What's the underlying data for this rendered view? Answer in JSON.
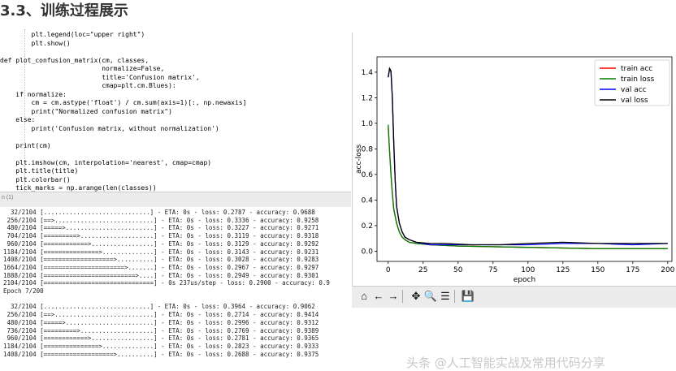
{
  "heading": "3.3、训练过程展示",
  "code_lines": [
    {
      "text": "        plt.legend(loc=\"upper right\")"
    },
    {
      "text": "        plt.show()"
    },
    {
      "text": ""
    },
    {
      "text": "def plot_confusion_matrix(cm, classes,"
    },
    {
      "text": "                          normalize=False,"
    },
    {
      "text": "                          title='Confusion matrix',"
    },
    {
      "text": "                          cmap=plt.cm.Blues):"
    },
    {
      "text": "    if normalize:"
    },
    {
      "text": "        cm = cm.astype('float') / cm.sum(axis=1)[:, np.newaxis]"
    },
    {
      "text": "        print(\"Normalized confusion matrix\")"
    },
    {
      "text": "    else:"
    },
    {
      "text": "        print('Confusion matrix, without normalization')"
    },
    {
      "text": ""
    },
    {
      "text": "    print(cm)"
    },
    {
      "text": ""
    },
    {
      "text": "    plt.imshow(cm, interpolation='nearest', cmap=cmap)"
    },
    {
      "text": "    plt.title(title)"
    },
    {
      "text": "    plt.colorbar()"
    },
    {
      "text": "    tick_marks = np.arange(len(classes))"
    }
  ],
  "panel_label": "n (1)",
  "console_lines": [
    "  32/2104 [.............................] - ETA: 0s - loss: 0.2787 - accuracy: 0.9688",
    " 256/2104 [==>...........................] - ETA: 0s - loss: 0.3336 - accuracy: 0.9258",
    " 480/2104 [=====>........................] - ETA: 0s - loss: 0.3227 - accuracy: 0.9271",
    " 704/2104 [=========>....................] - ETA: 0s - loss: 0.3119 - accuracy: 0.9318",
    " 960/2104 [============>.................] - ETA: 0s - loss: 0.3129 - accuracy: 0.9292",
    "1184/2104 [===============>..............] - ETA: 0s - loss: 0.3143 - accuracy: 0.9231",
    "1408/2104 [===================>..........] - ETA: 0s - loss: 0.3028 - accuracy: 0.9283",
    "1664/2104 [======================>.......] - ETA: 0s - loss: 0.2967 - accuracy: 0.9297",
    "1888/2104 [=========================>....] - ETA: 0s - loss: 0.2949 - accuracy: 0.9301",
    "2104/2104 [==============================] - 0s 237us/step - loss: 0.2900 - accuracy: 0.9",
    "Epoch 7/200",
    "",
    "  32/2104 [.............................] - ETA: 0s - loss: 0.3964 - accuracy: 0.9062",
    " 256/2104 [==>...........................] - ETA: 0s - loss: 0.2714 - accuracy: 0.9414",
    " 480/2104 [=====>........................] - ETA: 0s - loss: 0.2996 - accuracy: 0.9312",
    " 736/2104 [=========>....................] - ETA: 0s - loss: 0.2769 - accuracy: 0.9389",
    " 960/2104 [============>.................] - ETA: 0s - loss: 0.2781 - accuracy: 0.9365",
    "1184/2104 [===============>..............] - ETA: 0s - loss: 0.2823 - accuracy: 0.9333",
    "1408/2104 [===================>..........] - ETA: 0s - loss: 0.2688 - accuracy: 0.9375"
  ],
  "chart_data": {
    "type": "line",
    "xlabel": "epoch",
    "ylabel": "acc-loss",
    "xlim": [
      -8,
      203
    ],
    "ylim": [
      -0.08,
      1.52
    ],
    "xticks": [
      "0",
      "25",
      "50",
      "75",
      "100",
      "125",
      "150",
      "175",
      "200"
    ],
    "yticks": [
      "0.0",
      "0.2",
      "0.4",
      "0.6",
      "0.8",
      "1.0",
      "1.2",
      "1.4"
    ],
    "legend_position": "top-right",
    "grid": false,
    "series": [
      {
        "name": "train acc",
        "color": "#ff0000",
        "x": [
          0,
          1,
          2,
          3,
          4,
          6,
          8,
          10,
          12,
          15,
          20,
          30,
          50,
          100,
          150,
          200
        ],
        "y": [
          0.97,
          0.78,
          0.6,
          0.45,
          0.33,
          0.22,
          0.15,
          0.11,
          0.09,
          0.07,
          0.06,
          0.05,
          0.04,
          0.03,
          0.02,
          0.02
        ]
      },
      {
        "name": "train loss",
        "color": "#008000",
        "x": [
          0,
          1,
          2,
          3,
          4,
          6,
          8,
          10,
          12,
          15,
          20,
          30,
          50,
          100,
          150,
          200
        ],
        "y": [
          0.99,
          0.78,
          0.6,
          0.45,
          0.33,
          0.22,
          0.15,
          0.11,
          0.09,
          0.07,
          0.06,
          0.05,
          0.04,
          0.03,
          0.02,
          0.02
        ]
      },
      {
        "name": "val acc",
        "color": "#0000ff",
        "x": [
          0,
          1,
          2,
          3,
          4,
          5,
          6,
          8,
          10,
          12,
          15,
          20,
          30,
          40,
          60,
          80,
          100,
          125,
          150,
          175,
          200
        ],
        "y": [
          1.36,
          1.43,
          1.4,
          1.2,
          0.85,
          0.55,
          0.35,
          0.22,
          0.15,
          0.11,
          0.09,
          0.07,
          0.05,
          0.05,
          0.05,
          0.05,
          0.05,
          0.06,
          0.06,
          0.05,
          0.06
        ]
      },
      {
        "name": "val loss",
        "color": "#000000",
        "x": [
          0,
          1,
          2,
          3,
          4,
          5,
          6,
          8,
          10,
          12,
          15,
          20,
          30,
          40,
          60,
          80,
          100,
          125,
          150,
          175,
          200
        ],
        "y": [
          1.36,
          1.43,
          1.41,
          1.2,
          0.85,
          0.55,
          0.35,
          0.22,
          0.15,
          0.11,
          0.09,
          0.07,
          0.06,
          0.06,
          0.05,
          0.05,
          0.06,
          0.07,
          0.06,
          0.06,
          0.06
        ]
      }
    ]
  },
  "toolbar": [
    {
      "name": "home-icon",
      "glyph": "⌂"
    },
    {
      "name": "back-icon",
      "glyph": "←"
    },
    {
      "name": "forward-icon",
      "glyph": "→"
    },
    {
      "name": "pan-icon",
      "glyph": "✥"
    },
    {
      "name": "zoom-icon",
      "glyph": "🔍"
    },
    {
      "name": "configure-subplots-icon",
      "glyph": "☰"
    },
    {
      "name": "save-icon",
      "glyph": "💾"
    }
  ],
  "watermark": "头条 @人工智能实战及常用代码分享"
}
